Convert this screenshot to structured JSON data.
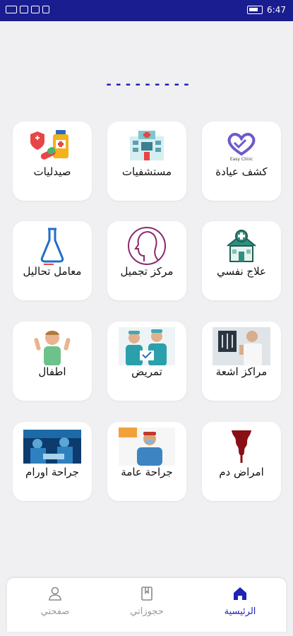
{
  "status_bar": {
    "time": "6:47"
  },
  "title_placeholder": "- - - - - - - - -",
  "categories": [
    {
      "label": "صيدليات",
      "icon": "pharmacy-icon"
    },
    {
      "label": "مستشفيات",
      "icon": "hospital-icon"
    },
    {
      "label": "كشف عيادة",
      "icon": "easy-clinic-logo",
      "logo_text": "Easy Clinic"
    },
    {
      "label": "معامل تحاليل",
      "icon": "lab-flask-icon"
    },
    {
      "label": "مركز تجميل",
      "icon": "beauty-face-icon"
    },
    {
      "label": "علاج نفسي",
      "icon": "mental-health-icon"
    },
    {
      "label": "اطفال",
      "icon": "child-photo"
    },
    {
      "label": "تمريض",
      "icon": "nurses-photo"
    },
    {
      "label": "مراكز اشعة",
      "icon": "xray-photo"
    },
    {
      "label": "جراحة اورام",
      "icon": "oncology-surgery-photo"
    },
    {
      "label": "جراحة عامة",
      "icon": "general-surgeon-photo"
    },
    {
      "label": "امراض دم",
      "icon": "blood-drop-icon"
    }
  ],
  "nav": {
    "home": "الرئيسية",
    "bookings": "حجوزاتي",
    "profile": "صفحتي"
  },
  "colors": {
    "primary": "#1d22b8",
    "status_bar": "#1a1d8f"
  }
}
